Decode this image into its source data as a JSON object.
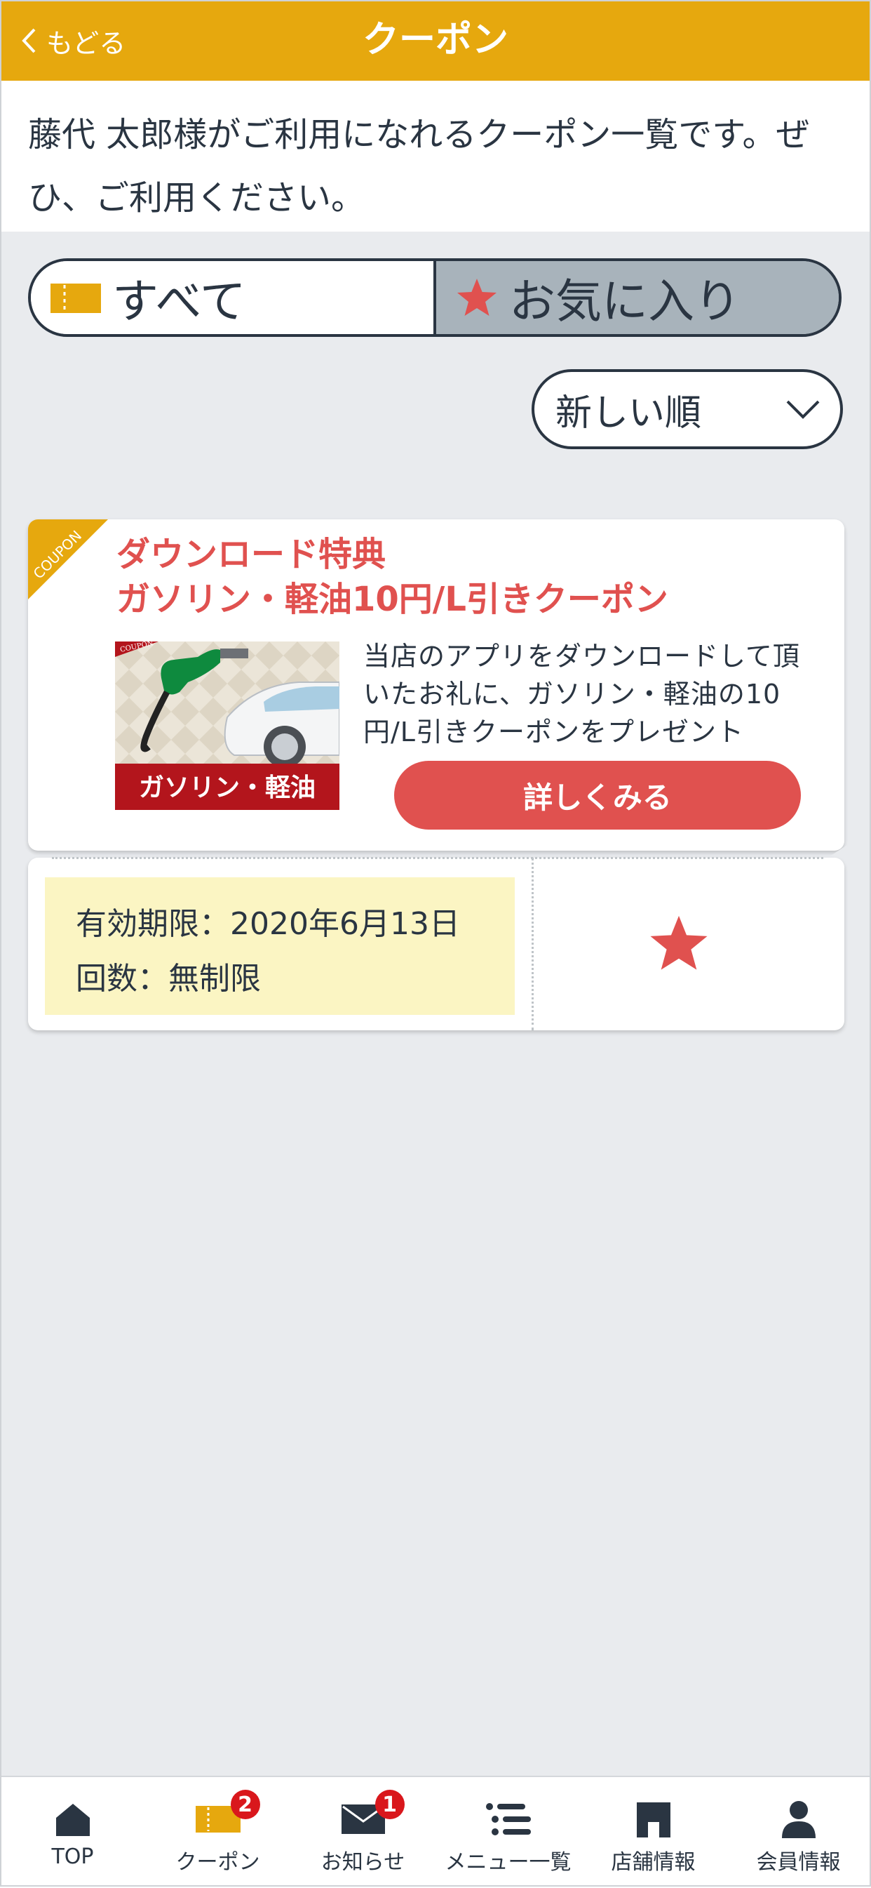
{
  "header": {
    "back_label": "もどる",
    "title": "クーポン"
  },
  "intro_text": "藤代 太郎様がご利用になれるクーポン一覧です。ぜひ、ご利用ください。",
  "filter": {
    "all_label": "すべて",
    "favorite_label": "お気に入り",
    "selected": "favorite"
  },
  "sort": {
    "selected": "新しい順"
  },
  "coupon": {
    "ribbon": "COUPON",
    "title_line1": "ダウンロード特典",
    "title_line2": "ガソリン・軽油10円/L引きクーポン",
    "thumb_ribbon": "COUPON",
    "thumb_caption": "ガソリン・軽油",
    "description": "当店のアプリをダウンロードして頂いたお礼に、ガソリン・軽油の10円/L引きクーポンをプレゼント",
    "detail_button": "詳しくみる",
    "validity": "有効期限：2020年6月13日",
    "uses": "回数：無制限",
    "favorite": true
  },
  "colors": {
    "accent": "#e6a80e",
    "red": "#e0514f",
    "navy": "#2a3542",
    "validity_bg": "#fbf5c3"
  },
  "tabbar": [
    {
      "label": "TOP",
      "icon": "home-icon"
    },
    {
      "label": "クーポン",
      "icon": "ticket-icon",
      "badge": "2"
    },
    {
      "label": "お知らせ",
      "icon": "mail-icon",
      "badge": "1"
    },
    {
      "label": "メニュー一覧",
      "icon": "list-icon"
    },
    {
      "label": "店舗情報",
      "icon": "store-icon"
    },
    {
      "label": "会員情報",
      "icon": "person-icon"
    }
  ]
}
